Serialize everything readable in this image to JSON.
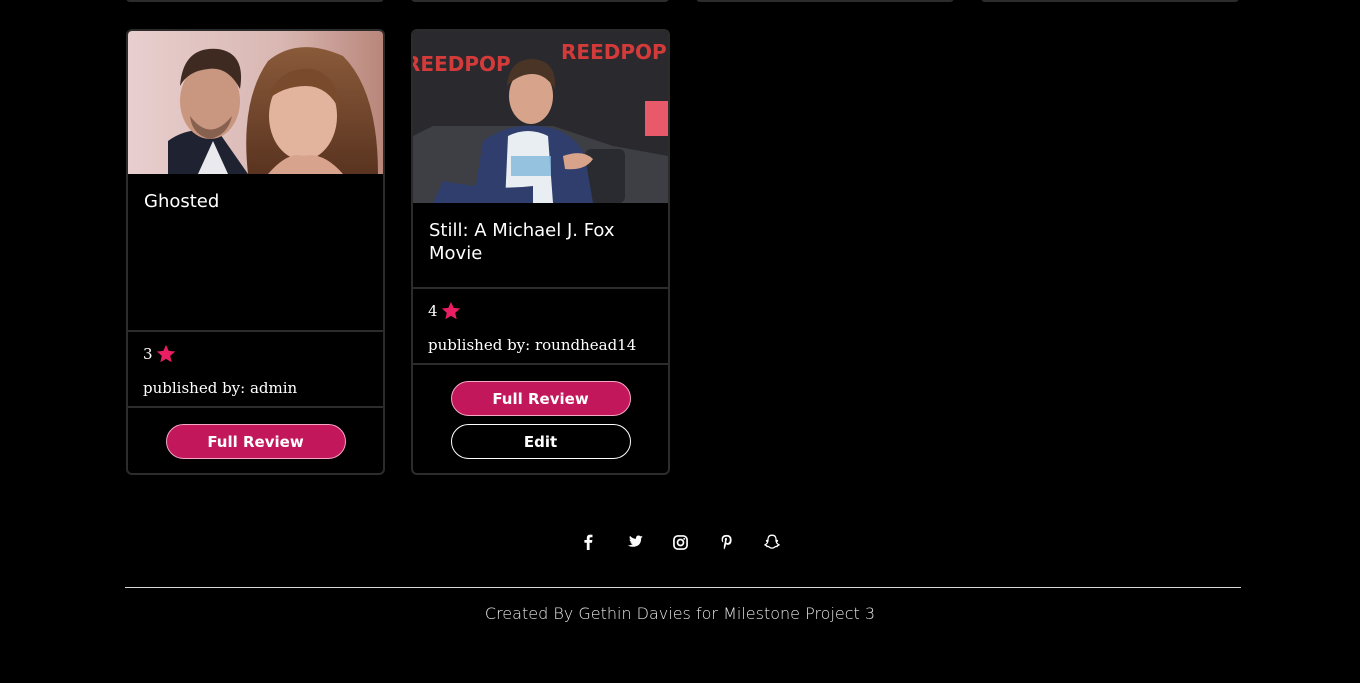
{
  "reviews": [
    {
      "title": "Ghosted",
      "rating": "3",
      "publisher_label": "published by: admin",
      "buttons": {
        "full_review": "Full Review"
      }
    },
    {
      "title": "Still: A Michael J. Fox Movie",
      "rating": "4",
      "publisher_label": "published by: roundhead14",
      "buttons": {
        "full_review": "Full Review",
        "edit": "Edit"
      }
    }
  ],
  "footer": {
    "social_icons": [
      "facebook-icon",
      "twitter-icon",
      "instagram-icon",
      "pinterest-icon",
      "snapchat-icon"
    ],
    "credit": "Created By Gethin Davies for Milestone Project 3"
  },
  "colors": {
    "accent": "#c2185b",
    "star": "#e91e63",
    "border": "#2c2c2c",
    "background": "#000000"
  }
}
